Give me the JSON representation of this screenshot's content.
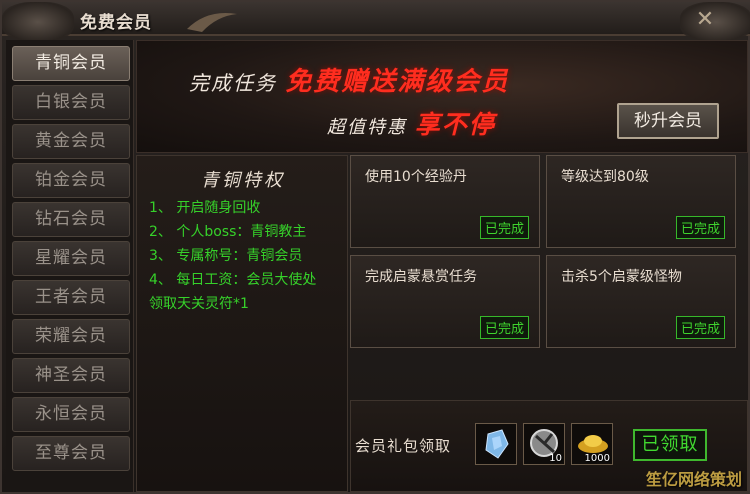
{
  "window": {
    "title": "免费会员"
  },
  "sidebar": {
    "items": [
      {
        "label": "青铜会员",
        "active": true
      },
      {
        "label": "白银会员",
        "active": false
      },
      {
        "label": "黄金会员",
        "active": false
      },
      {
        "label": "铂金会员",
        "active": false
      },
      {
        "label": "钻石会员",
        "active": false
      },
      {
        "label": "星耀会员",
        "active": false
      },
      {
        "label": "王者会员",
        "active": false
      },
      {
        "label": "荣耀会员",
        "active": false
      },
      {
        "label": "神圣会员",
        "active": false
      },
      {
        "label": "永恒会员",
        "active": false
      },
      {
        "label": "至尊会员",
        "active": false
      }
    ]
  },
  "banner": {
    "line1_prefix": "完成任务",
    "line1_highlight": "免费赠送满级会员",
    "line2_prefix": "超值特惠",
    "line2_highlight": "享不停",
    "upgrade_button": "秒升会员"
  },
  "privileges": {
    "title": "青铜特权",
    "items": [
      "1、 开启随身回收",
      "2、 个人boss：青铜教主",
      "3、 专属称号：青铜会员",
      "4、 每日工资：会员大使处",
      "领取天关灵符*1"
    ]
  },
  "tasks": [
    {
      "label": "使用10个经验丹",
      "status": "已完成"
    },
    {
      "label": "等级达到80级",
      "status": "已完成"
    },
    {
      "label": "完成启蒙悬赏任务",
      "status": "已完成"
    },
    {
      "label": "击杀5个启蒙级怪物",
      "status": "已完成"
    }
  ],
  "gift": {
    "label": "会员礼包领取",
    "items": [
      {
        "icon": "crystal-icon",
        "count": ""
      },
      {
        "icon": "rune-stone-icon",
        "count": "10"
      },
      {
        "icon": "gold-ingot-icon",
        "count": "1000"
      }
    ],
    "claim_button": "已领取"
  },
  "watermark": "笙亿网络策划",
  "colors": {
    "accent_red": "#ff2d1f",
    "accent_green": "#36d12a",
    "text_light": "#e8ddd0"
  }
}
